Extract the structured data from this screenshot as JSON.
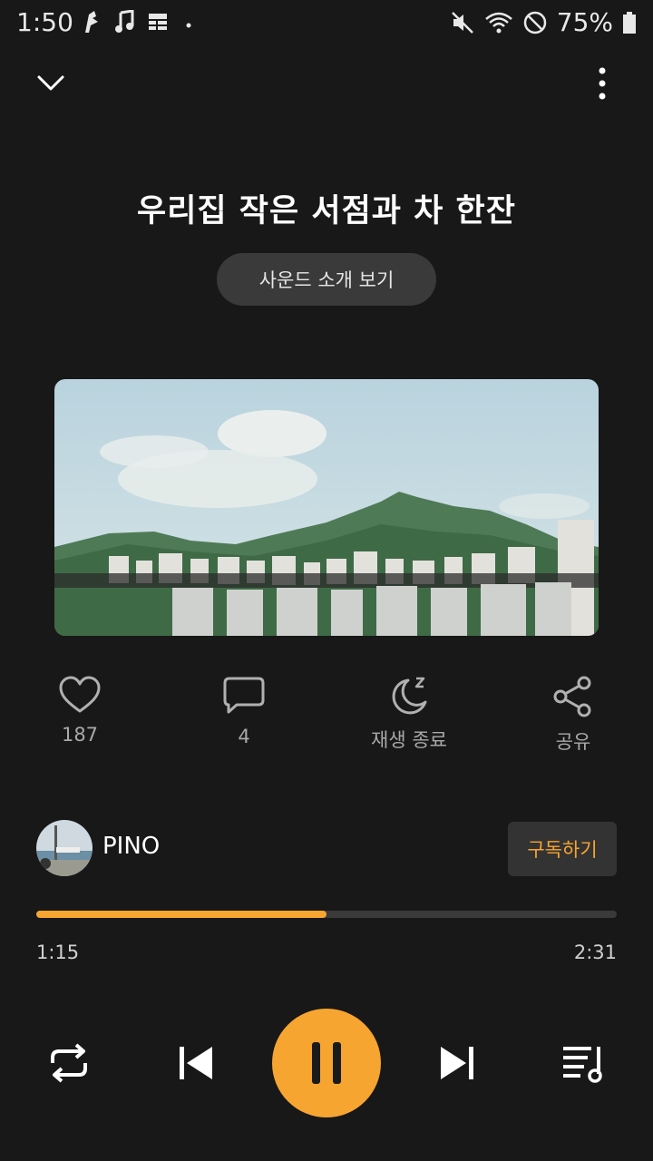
{
  "status_bar": {
    "time": "1:50",
    "battery": "75%"
  },
  "track": {
    "title": "우리집 작은 서점과 차 한잔",
    "sound_intro_label": "사운드 소개 보기"
  },
  "actions": {
    "like_count": "187",
    "comment_count": "4",
    "sleep_label": "재생 종료",
    "share_label": "공유"
  },
  "uploader": {
    "name": "PINO",
    "subscribe_label": "구독하기"
  },
  "playback": {
    "current": "1:15",
    "total": "2:31",
    "progress": 0.5
  },
  "colors": {
    "accent": "#f7a531",
    "background": "#181818"
  }
}
